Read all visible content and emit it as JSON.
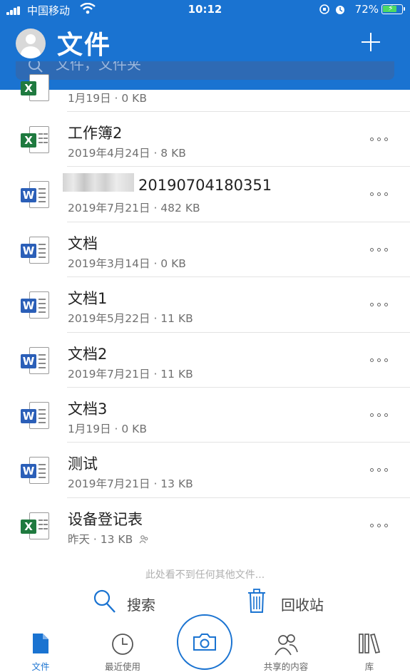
{
  "status_bar": {
    "carrier": "中国移动",
    "time": "10:12",
    "battery": "72%"
  },
  "header": {
    "title": "文件",
    "search_placeholder": "文件，文件夹"
  },
  "files": [
    {
      "name": "",
      "meta": "1月19日 · 0 KB",
      "type": "excel",
      "partial": true
    },
    {
      "name": "工作簿2",
      "meta": "2019年4月24日 · 8 KB",
      "type": "excel"
    },
    {
      "name": "20190704180351",
      "meta": "2019年7月21日 · 482 KB",
      "type": "word",
      "blurred_prefix": true
    },
    {
      "name": "文档",
      "meta": "2019年3月14日 · 0 KB",
      "type": "word"
    },
    {
      "name": "文档1",
      "meta": "2019年5月22日 · 11 KB",
      "type": "word"
    },
    {
      "name": "文档2",
      "meta": "2019年7月21日 · 11 KB",
      "type": "word"
    },
    {
      "name": "文档3",
      "meta": "1月19日 · 0 KB",
      "type": "word"
    },
    {
      "name": "测试",
      "meta": "2019年7月21日 · 13 KB",
      "type": "word"
    },
    {
      "name": "设备登记表",
      "meta": "昨天 · 13 KB",
      "type": "excel",
      "shared": true
    }
  ],
  "footer": {
    "empty_note": "此处看不到任何其他文件...",
    "search_label": "搜索",
    "recycle_label": "回收站"
  },
  "tabs": [
    {
      "label": "文件",
      "icon": "file-icon",
      "active": true
    },
    {
      "label": "最近使用",
      "icon": "clock-icon"
    },
    {
      "label": "",
      "icon": "camera-icon"
    },
    {
      "label": "共享的内容",
      "icon": "people-icon"
    },
    {
      "label": "库",
      "icon": "library-icon"
    }
  ],
  "colors": {
    "accent": "#1a73d1",
    "word": "#2b5fb8",
    "excel": "#1f7a3f"
  }
}
